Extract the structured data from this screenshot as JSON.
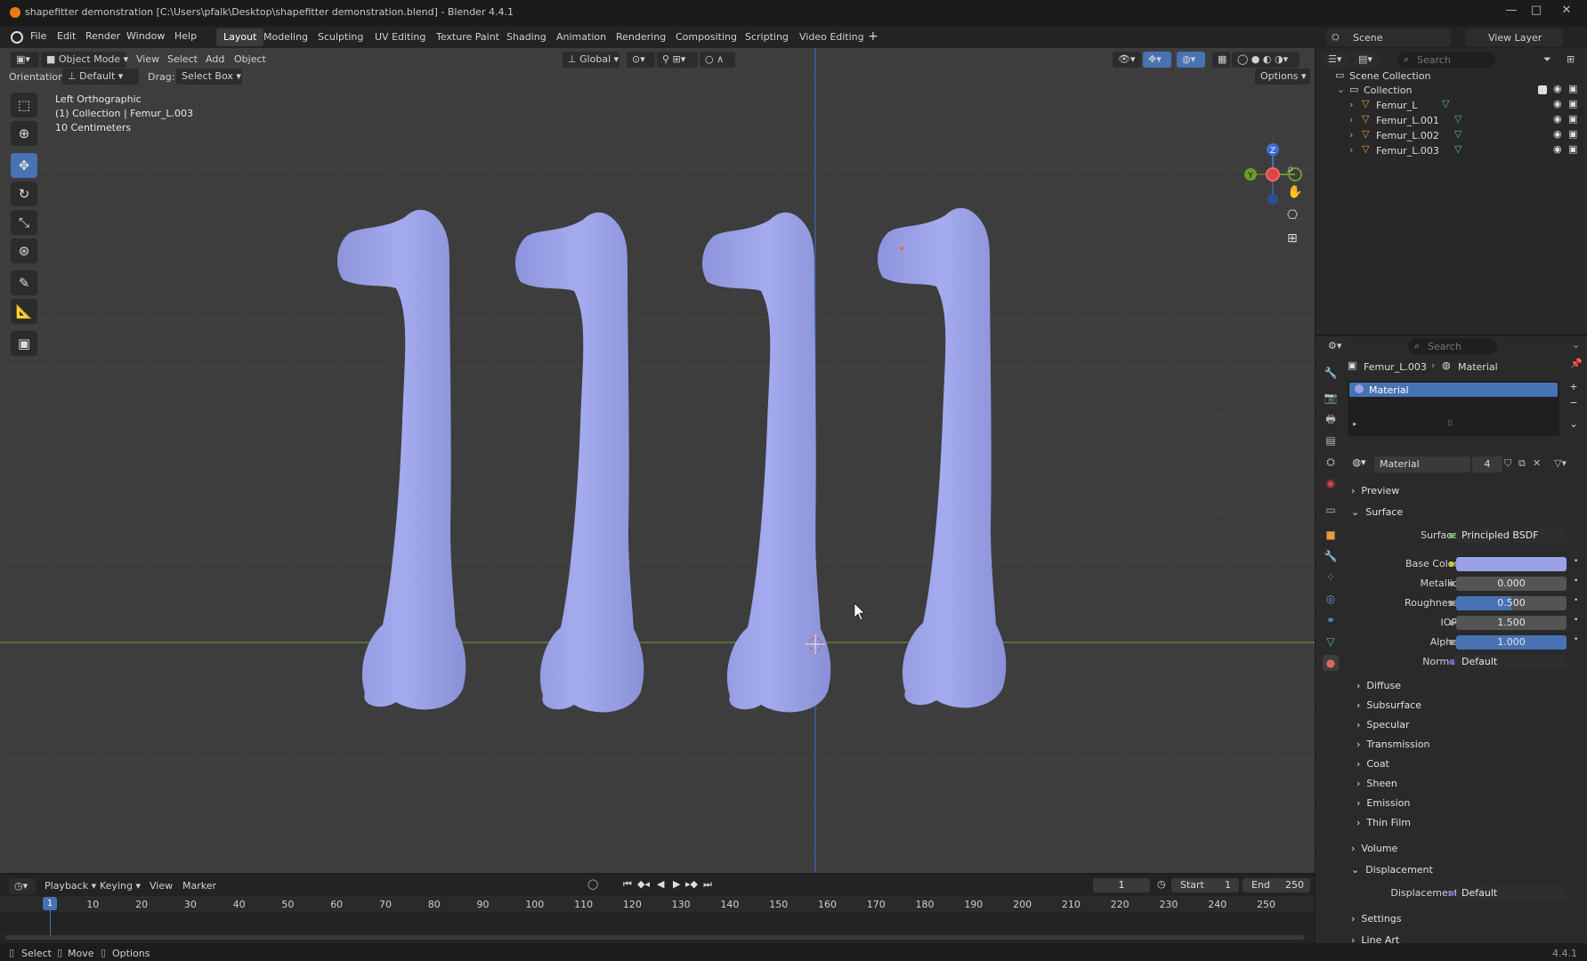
{
  "window": {
    "title": "shapefitter demonstration [C:\\Users\\pfalk\\Desktop\\shapefitter demonstration.blend] - Blender 4.4.1"
  },
  "menu": {
    "items": [
      "File",
      "Edit",
      "Render",
      "Window",
      "Help"
    ]
  },
  "workspaces": [
    "Layout",
    "Modeling",
    "Sculpting",
    "UV Editing",
    "Texture Paint",
    "Shading",
    "Animation",
    "Rendering",
    "Compositing",
    "Scripting",
    "Video Editing"
  ],
  "active_workspace": "Layout",
  "scene": {
    "name": "Scene",
    "view_layer": "View Layer"
  },
  "viewport": {
    "mode": "Object Mode",
    "menus": [
      "View",
      "Select",
      "Add",
      "Object"
    ],
    "transform": "Global",
    "orientation_label": "Orientation:",
    "orientation_value": "Default",
    "drag_label": "Drag:",
    "drag_value": "Select Box",
    "options_label": "Options",
    "overlay": {
      "view_name": "Left Orthographic",
      "collection_line": "(1) Collection | Femur_L.003",
      "scale_line": "10 Centimeters"
    },
    "gizmo": {
      "z": "Z",
      "y": "Y"
    }
  },
  "outliner": {
    "search_placeholder": "Search",
    "root": "Scene Collection",
    "collection": "Collection",
    "objects": [
      "Femur_L",
      "Femur_L.001",
      "Femur_L.002",
      "Femur_L.003"
    ]
  },
  "properties": {
    "search_placeholder": "Search",
    "breadcrumb_object": "Femur_L.003",
    "breadcrumb_tab": "Material",
    "slot_name": "Material",
    "material_name": "Material",
    "material_users": "4",
    "sections": {
      "preview": "Preview",
      "surface": "Surface",
      "diffuse": "Diffuse",
      "subsurface": "Subsurface",
      "specular": "Specular",
      "transmission": "Transmission",
      "coat": "Coat",
      "sheen": "Sheen",
      "emission": "Emission",
      "thin_film": "Thin Film",
      "volume": "Volume",
      "displacement": "Displacement",
      "settings": "Settings",
      "line_art": "Line Art"
    },
    "fields": {
      "surface_label": "Surface",
      "surface_value": "Principled BSDF",
      "base_color_label": "Base Color",
      "base_color_hex": "#9aa1e8",
      "metallic_label": "Metallic",
      "metallic_value": "0.000",
      "roughness_label": "Roughness",
      "roughness_value": "0.500",
      "roughness_fraction": 0.5,
      "ior_label": "IOR",
      "ior_value": "1.500",
      "alpha_label": "Alpha",
      "alpha_value": "1.000",
      "alpha_fraction": 1.0,
      "normal_label": "Normal",
      "normal_value": "Default",
      "displacement_label": "Displacement",
      "displacement_value": "Default"
    }
  },
  "timeline": {
    "menus": [
      "Playback",
      "Keying",
      "View",
      "Marker"
    ],
    "current_frame": "1",
    "start_label": "Start",
    "start_value": "1",
    "end_label": "End",
    "end_value": "250",
    "ticks": [
      "1",
      "10",
      "20",
      "30",
      "40",
      "50",
      "60",
      "70",
      "80",
      "90",
      "100",
      "110",
      "120",
      "130",
      "140",
      "150",
      "160",
      "170",
      "180",
      "190",
      "200",
      "210",
      "220",
      "230",
      "240",
      "250"
    ]
  },
  "statusbar": {
    "select": "Select",
    "move": "Move",
    "options": "Options",
    "version": "4.4.1"
  },
  "colors": {
    "accent": "#4772b3",
    "bone": "#9aa1e8",
    "viewport_bg": "#3d3d3d"
  }
}
